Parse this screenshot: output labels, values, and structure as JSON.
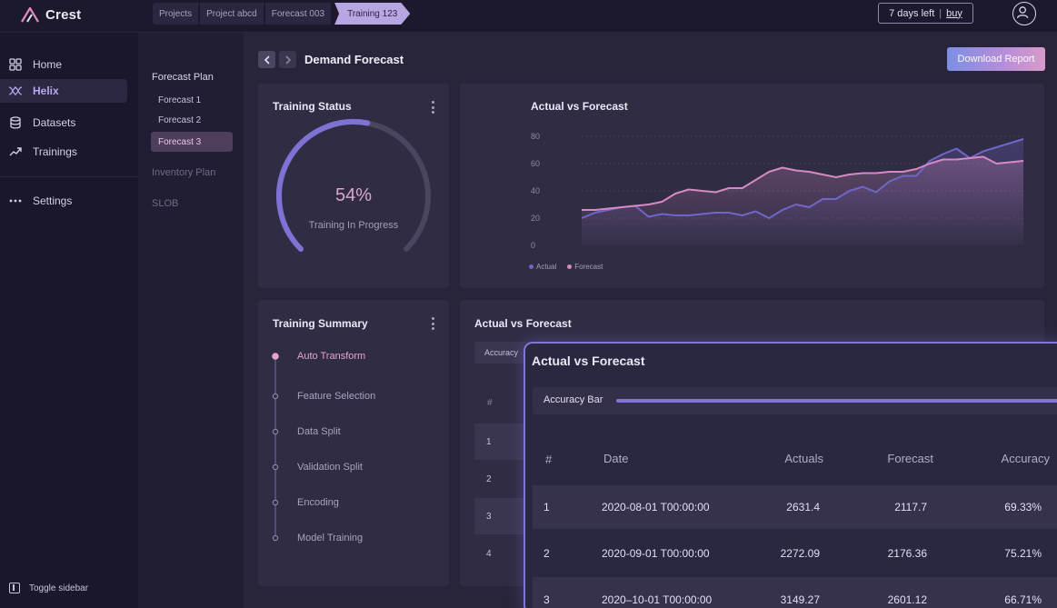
{
  "app": {
    "name": "Crest",
    "brand_color": "#b98ed8",
    "accent": "#7e76d8"
  },
  "breadcrumbs": [
    "Projects",
    "Project abcd",
    "Forecast 003",
    "Training 123"
  ],
  "trial": {
    "text": "7 days left",
    "separator": "|",
    "buy": "buy"
  },
  "sidebar": {
    "items": [
      {
        "label": "Home",
        "icon": "grid-icon"
      },
      {
        "label": "Helix",
        "icon": "helix-icon",
        "active": true
      },
      {
        "label": "Datasets",
        "icon": "database-icon"
      },
      {
        "label": "Trainings",
        "icon": "trend-icon"
      },
      {
        "label": "Settings",
        "icon": "more-icon"
      }
    ],
    "toggle": "Toggle sidebar"
  },
  "subpanel": {
    "forecast_plan": "Forecast Plan",
    "items": [
      "Forecast 1",
      "Forecast 2",
      "Forecast 3"
    ],
    "active_item": "Forecast 3",
    "inventory_plan": "Inventory Plan",
    "slob": "SLOB"
  },
  "header": {
    "title": "Demand Forecast",
    "download": "Download Report"
  },
  "training_status": {
    "title": "Training Status",
    "percent": "54%",
    "progress": 0.54,
    "label": "Training In Progress"
  },
  "chart_data": {
    "type": "line",
    "title": "Actual vs Forecast",
    "xlabel": "",
    "ylabel": "",
    "ylim": [
      0,
      80
    ],
    "yticks": [
      0,
      20,
      40,
      60,
      80
    ],
    "grid": true,
    "legend_position": "bottom-left",
    "series": [
      {
        "name": "Actual",
        "color": "#6f66c9",
        "values": [
          20,
          24,
          26,
          28,
          29,
          21,
          23,
          22,
          22,
          23,
          24,
          24,
          22,
          25,
          20,
          26,
          30,
          28,
          34,
          34,
          40,
          43,
          39,
          47,
          51,
          51,
          62,
          67,
          71,
          64,
          69,
          72,
          75,
          78
        ]
      },
      {
        "name": "Forecast",
        "color": "#d68ac2",
        "values": [
          26,
          26,
          27,
          28,
          29,
          30,
          32,
          38,
          41,
          40,
          39,
          42,
          42,
          48,
          54,
          57,
          55,
          54,
          52,
          50,
          52,
          53,
          53,
          54,
          54,
          56,
          60,
          63,
          63,
          64,
          65,
          60,
          61,
          62
        ]
      }
    ]
  },
  "training_summary": {
    "title": "Training Summary",
    "steps": [
      "Auto Transform",
      "Feature Selection",
      "Data Split",
      "Validation Split",
      "Encoding",
      "Model Training"
    ],
    "active_step": 0
  },
  "bg_table": {
    "title": "Actual vs Forecast",
    "pill": "Accuracy",
    "hash": "#",
    "rows": [
      "1",
      "2",
      "3",
      "4"
    ]
  },
  "popup": {
    "title": "Actual vs Forecast",
    "accuracy_label": "Accuracy Bar",
    "columns": [
      "#",
      "Date",
      "Actuals",
      "Forecast",
      "Accuracy"
    ],
    "rows": [
      [
        "1",
        "2020-08-01 T00:00:00",
        "2631.4",
        "2117.7",
        "69.33%"
      ],
      [
        "2",
        "2020-09-01 T00:00:00",
        "2272.09",
        "2176.36",
        "75.21%"
      ],
      [
        "3",
        "2020–10-01 T00:00:00",
        "3149.27",
        "2601.12",
        "66.71%"
      ]
    ]
  }
}
